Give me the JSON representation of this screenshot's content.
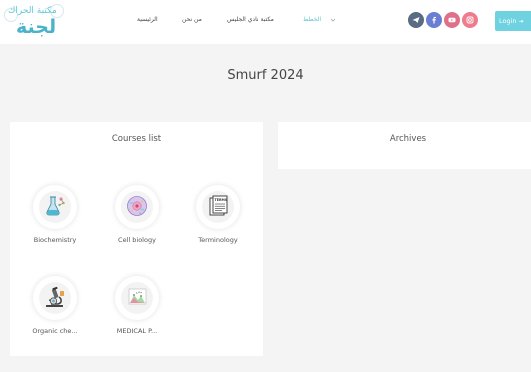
{
  "header": {
    "logo": {
      "small_text": "مكتبة الحراك",
      "main_text": "لجنة",
      "icon": "heart-logo"
    },
    "nav": [
      {
        "label": "الخطط",
        "active": true
      },
      {
        "label": "مكتبة نادي الجليس",
        "active": false
      },
      {
        "label": "من نحن",
        "active": false
      },
      {
        "label": "الرئيسية",
        "active": false
      }
    ],
    "social": [
      {
        "icon": "paper-plane-icon",
        "color": "#5a6b84"
      },
      {
        "icon": "facebook-icon",
        "color": "#6a7ed4"
      },
      {
        "icon": "youtube-icon",
        "color": "#e0708a"
      },
      {
        "icon": "instagram-icon",
        "color": "#ee7c8e"
      }
    ],
    "login": {
      "label": "Login",
      "icon": "login-arrow-icon",
      "color": "#6fd2e0"
    }
  },
  "page": {
    "title": "Smurf 2024"
  },
  "courses": {
    "title": "Courses list",
    "items": [
      {
        "label": "Biochemistry",
        "icon": "biochemistry-icon"
      },
      {
        "label": "Cell biology",
        "icon": "cell-icon"
      },
      {
        "label": "Terminology",
        "icon": "terms-document-icon"
      },
      {
        "label": "Organic che...",
        "icon": "microscope-icon"
      },
      {
        "label": "MEDICAL P...",
        "icon": "medical-chart-icon"
      }
    ]
  },
  "archives": {
    "title": "Archives"
  },
  "colors": {
    "accent": "#5cc3d3",
    "background": "#f4f4f4",
    "card": "#ffffff"
  }
}
